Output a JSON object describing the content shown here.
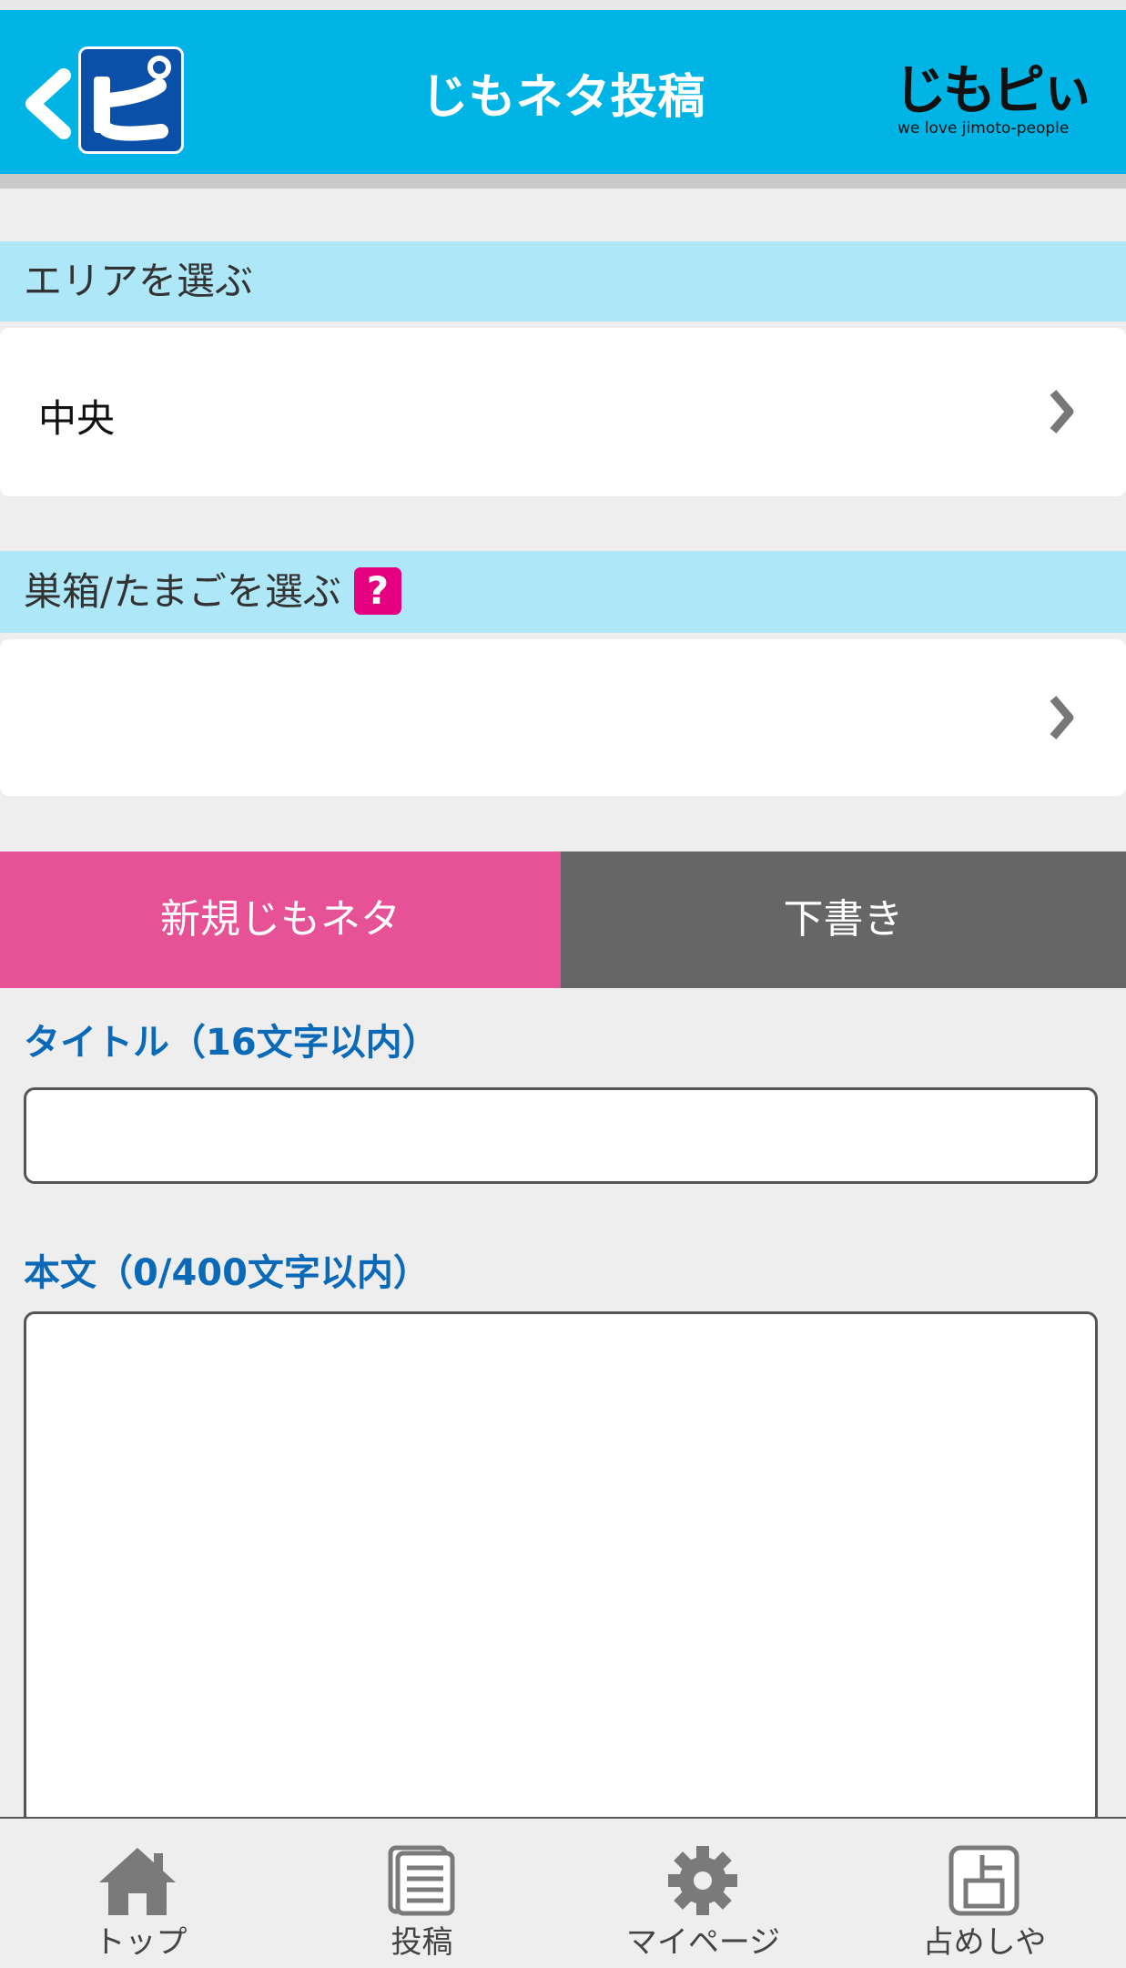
{
  "header": {
    "title": "じもネタ投稿",
    "app_logo_char": "ピ",
    "brand_name": "じもピぃ",
    "brand_tagline": "we love jimoto-people",
    "bg_color": "#00b4e6"
  },
  "area": {
    "label": "エリアを選ぶ",
    "value": "中央"
  },
  "nest": {
    "label": "巣箱/たまごを選ぶ",
    "help": "?",
    "value": ""
  },
  "post_tabs": {
    "new_label": "新規じもネタ",
    "draft_label": "下書き",
    "active_color": "#e75297",
    "inactive_color": "#666666"
  },
  "form": {
    "title_label": "タイトル（16文字以内）",
    "title_value": "",
    "body_label": "本文（0/400文字以内）",
    "body_value": ""
  },
  "tabbar": {
    "items": [
      {
        "label": "トップ",
        "icon": "home-icon"
      },
      {
        "label": "投稿",
        "icon": "document-icon"
      },
      {
        "label": "マイページ",
        "icon": "gear-icon"
      },
      {
        "label": "占めしや",
        "icon": "fortune-icon"
      }
    ]
  }
}
